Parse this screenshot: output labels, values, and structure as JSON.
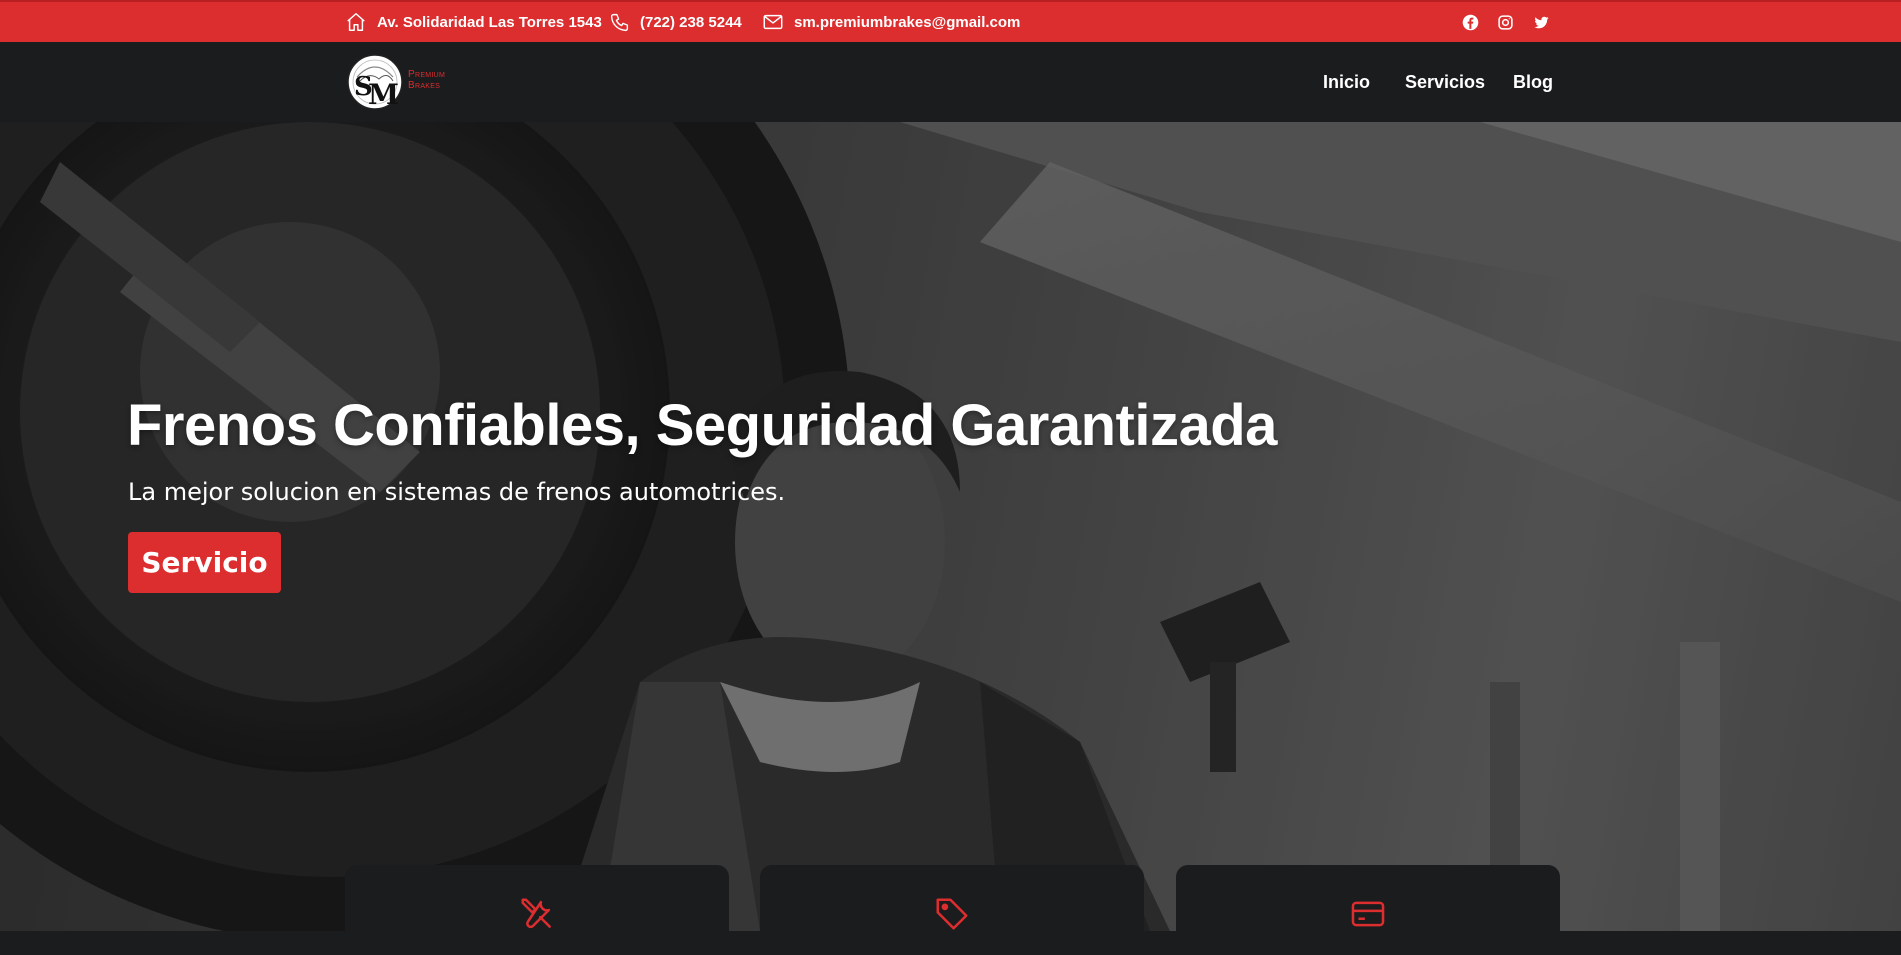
{
  "topbar": {
    "address": "Av. Solidaridad Las Torres 1543",
    "phone": "(722) 238 5244",
    "email": "sm.premiumbrakes@gmail.com",
    "icons": [
      "home-icon",
      "phone-icon",
      "mail-icon",
      "facebook-icon",
      "instagram-icon",
      "twitter-icon"
    ]
  },
  "logo": {
    "line1": "Premium",
    "line2": "Brakes"
  },
  "nav": {
    "items": [
      {
        "label": "Inicio"
      },
      {
        "label": "Servicios"
      },
      {
        "label": "Blog"
      }
    ]
  },
  "hero": {
    "title": "Frenos Confiables, Seguridad Garantizada",
    "subtitle": "La mejor solucion en sistemas de frenos automotrices.",
    "button_label": "Servicio"
  },
  "cards": [
    {
      "icon": "tools-icon"
    },
    {
      "icon": "tag-icon"
    },
    {
      "icon": "credit-card-icon"
    }
  ],
  "colors": {
    "accent": "#dc2d2f",
    "dark": "#1b1c1e",
    "text": "#ffffff"
  }
}
